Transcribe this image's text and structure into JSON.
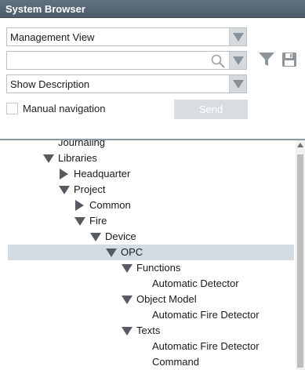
{
  "window": {
    "title": "System Browser"
  },
  "view_select": {
    "value": "Management View"
  },
  "search": {
    "value": "",
    "placeholder": ""
  },
  "description_select": {
    "value": "Show Description"
  },
  "manual_navigation": {
    "label": "Manual navigation",
    "checked": false
  },
  "send_button": {
    "label": "Send",
    "enabled": false
  },
  "icons": {
    "search": "magnifier-icon",
    "filter": "funnel-filter-icon",
    "save": "floppy-save-icon",
    "expanded": "triangle-down-icon",
    "collapsed": "triangle-right-icon"
  },
  "colors": {
    "titlebar": "#56677a",
    "selection": "#d3dce3",
    "disabled_button": "#d7dde0",
    "expander": "#555b60"
  },
  "tree": {
    "nodes": [
      {
        "label": "Journaling",
        "level": 0,
        "state": "none"
      },
      {
        "label": "Libraries",
        "level": 0,
        "state": "expanded"
      },
      {
        "label": "Headquarter",
        "level": 1,
        "state": "collapsed"
      },
      {
        "label": "Project",
        "level": 1,
        "state": "expanded"
      },
      {
        "label": "Common",
        "level": 2,
        "state": "collapsed"
      },
      {
        "label": "Fire",
        "level": 2,
        "state": "expanded"
      },
      {
        "label": "Device",
        "level": 3,
        "state": "expanded"
      },
      {
        "label": "OPC",
        "level": 4,
        "state": "expanded",
        "selected": true
      },
      {
        "label": "Functions",
        "level": 5,
        "state": "expanded"
      },
      {
        "label": "Automatic Detector",
        "level": 6,
        "state": "none"
      },
      {
        "label": "Object Model",
        "level": 5,
        "state": "expanded"
      },
      {
        "label": "Automatic Fire Detector",
        "level": 6,
        "state": "none"
      },
      {
        "label": "Texts",
        "level": 5,
        "state": "expanded"
      },
      {
        "label": "Automatic Fire Detector",
        "level": 6,
        "state": "none"
      },
      {
        "label": "Command",
        "level": 6,
        "state": "none"
      }
    ]
  }
}
